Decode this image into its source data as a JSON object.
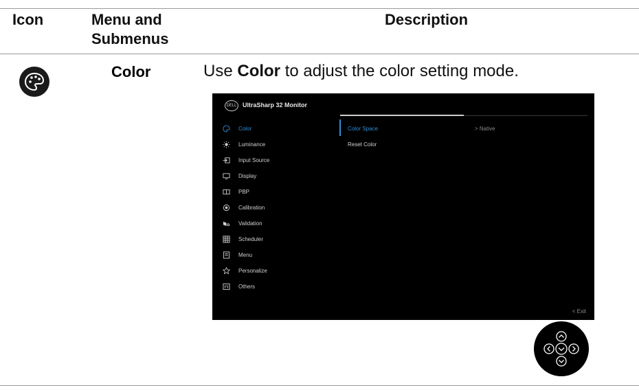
{
  "headers": {
    "icon": "Icon",
    "menu_line1": "Menu and",
    "menu_line2": "Submenus",
    "description": "Description"
  },
  "row": {
    "icon_name": "color-palette-icon",
    "title": "Color",
    "desc_prefix": "Use ",
    "desc_bold": "Color",
    "desc_suffix": " to adjust the color setting mode."
  },
  "osd": {
    "logo": "DELL",
    "title": "UltraSharp 32 Monitor",
    "menu": [
      {
        "label": "Color",
        "icon": "palette-icon",
        "active": true
      },
      {
        "label": "Luminance",
        "icon": "sun-icon"
      },
      {
        "label": "Input Source",
        "icon": "input-icon"
      },
      {
        "label": "Display",
        "icon": "monitor-icon"
      },
      {
        "label": "PBP",
        "icon": "pbp-icon"
      },
      {
        "label": "Calibration",
        "icon": "target-icon"
      },
      {
        "label": "Validation",
        "icon": "validation-icon"
      },
      {
        "label": "Scheduler",
        "icon": "grid-icon"
      },
      {
        "label": "Menu",
        "icon": "list-icon"
      },
      {
        "label": "Personalize",
        "icon": "star-icon"
      },
      {
        "label": "Others",
        "icon": "info-icon"
      }
    ],
    "submenu": [
      {
        "label": "Color Space",
        "value": "> Native",
        "active": true
      },
      {
        "label": "Reset Color",
        "value": ""
      }
    ],
    "exit": "< Exit"
  },
  "colors": {
    "accent": "#2f8ed8",
    "osd_bg": "#000000"
  }
}
